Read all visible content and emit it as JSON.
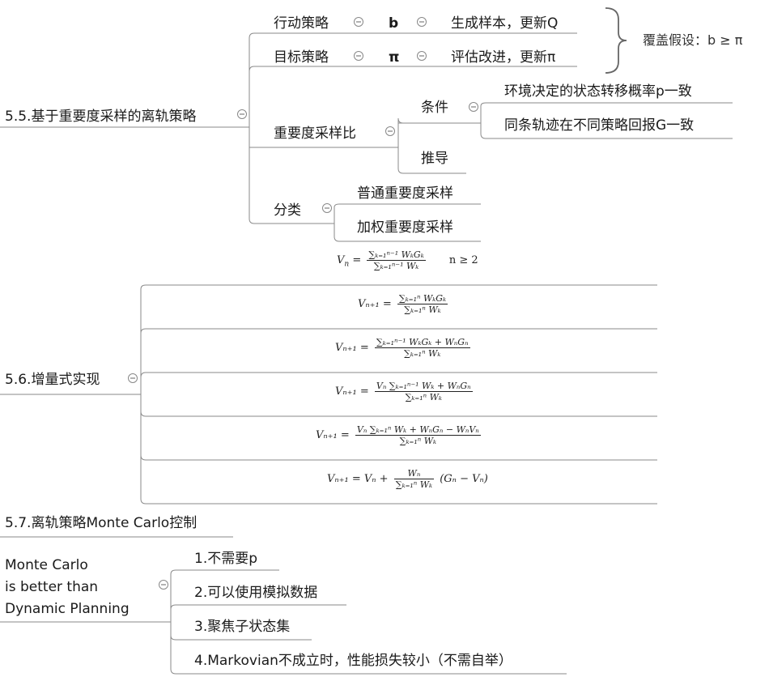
{
  "s55": {
    "title": "5.5.基于重要度采样的离轨策略",
    "behavior_policy": "行动策略",
    "behavior_symbol": "b",
    "behavior_desc": "生成样本，更新Q",
    "target_policy": "目标策略",
    "target_symbol": "π",
    "target_desc": "评估改进，更新π",
    "coverage": "覆盖假设：b ≥ π",
    "ratio": "重要度采样比",
    "condition": "条件",
    "cond1": "环境决定的状态转移概率p一致",
    "cond2": "同条轨迹在不同策略回报G一致",
    "derive": "推导",
    "classify": "分类",
    "ordinary": "普通重要度采样",
    "weighted": "加权重要度采样"
  },
  "s56": {
    "title": "5.6.增量式实现",
    "f0_lhs": "V",
    "f0_sub": "n",
    "f0_num": "∑ₖ₌₁ⁿ⁻¹ WₖGₖ",
    "f0_den": "∑ₖ₌₁ⁿ⁻¹ Wₖ",
    "f0_cond": "n ≥ 2",
    "f1_lhs": "Vₙ₊₁ =",
    "f1_num": "∑ₖ₌₁ⁿ WₖGₖ",
    "f1_den": "∑ₖ₌₁ⁿ Wₖ",
    "f2_lhs": "Vₙ₊₁ =",
    "f2_num": "∑ₖ₌₁ⁿ⁻¹ WₖGₖ + WₙGₙ",
    "f2_den": "∑ₖ₌₁ⁿ Wₖ",
    "f3_lhs": "Vₙ₊₁ =",
    "f3_num": "Vₙ ∑ₖ₌₁ⁿ⁻¹ Wₖ + WₙGₙ",
    "f3_den": "∑ₖ₌₁ⁿ Wₖ",
    "f4_lhs": "Vₙ₊₁ =",
    "f4_num": "Vₙ ∑ₖ₌₁ⁿ Wₖ + WₙGₙ − WₙVₙ",
    "f4_den": "∑ₖ₌₁ⁿ Wₖ",
    "f5_lhs": "Vₙ₊₁ = Vₙ +",
    "f5_num": "Wₙ",
    "f5_den": "∑ₖ₌₁ⁿ Wₖ",
    "f5_rhs": "(Gₙ − Vₙ)"
  },
  "s57": {
    "title": "5.7.离轨策略Monte Carlo控制"
  },
  "mc": {
    "title_line1": "Monte Carlo",
    "title_line2": "is better than",
    "title_line3": "Dynamic Planning",
    "item1": "1.不需要p",
    "item2": "2.可以使用模拟数据",
    "item3": "3.聚焦子状态集",
    "item4": "4.Markovian不成立时，性能损失较小（不需自举）"
  },
  "colors": {
    "line": "#7a7a7a",
    "text": "#1a1a1a"
  }
}
